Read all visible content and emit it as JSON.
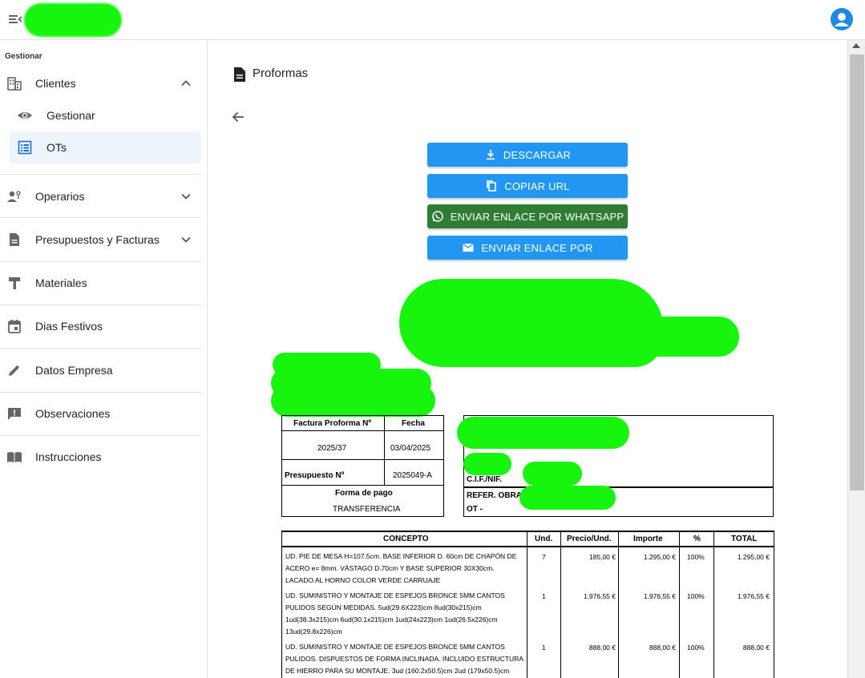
{
  "sidebar": {
    "section_title": "Gestionar",
    "items": [
      {
        "label": "Clientes"
      },
      {
        "label": "Gestionar"
      },
      {
        "label": "OTs"
      },
      {
        "label": "Operarios"
      },
      {
        "label": "Presupuestos y Facturas"
      },
      {
        "label": "Materiales"
      },
      {
        "label": "Dias Festivos"
      },
      {
        "label": "Datos Empresa"
      },
      {
        "label": "Observaciones"
      },
      {
        "label": "Instrucciones"
      }
    ]
  },
  "main": {
    "title": "Proformas",
    "buttons": {
      "download": "DESCARGAR",
      "copy_url": "COPIAR URL",
      "whatsapp": "ENVIAR ENLACE POR WHATSAPP",
      "email": "ENVIAR ENLACE POR"
    }
  },
  "invoice": {
    "header": {
      "number_label": "Factura Proforma Nº",
      "date_label": "Fecha",
      "number": "2025/37",
      "date": "03/04/2025",
      "budget_label": "Presupuesto Nº",
      "budget": "2025049-A",
      "payment_label": "Forma de pago",
      "payment": "TRANSFERENCIA",
      "cif_label": "C.I.F./NIF.",
      "ref_label": "REFER. OBRA",
      "ot_label": "OT -"
    },
    "columns": [
      "CONCEPTO",
      "Und.",
      "Precio/Und.",
      "Importe",
      "%",
      "TOTAL"
    ],
    "rows": [
      {
        "concepto": [
          "UD. PIE DE MESA H=107.5cm. BASE INFERIOR D. 60cm DE CHAPÓN DE",
          "ACERO e= 8mm. VÁSTAGO D.70cm Y BASE SUPERIOR 30X30cm.",
          "LACADO AL HORNO COLOR VERDE CARRUAJE"
        ],
        "und": "7",
        "precio": "185,00 €",
        "importe": "1.295,00 €",
        "pct": "100%",
        "total": "1.295,00 €"
      },
      {
        "concepto": [
          "UD. SUMINISTRO Y MONTAJE DE ESPEJOS BRONCE 5MM CANTOS",
          "PULIDOS SEGÚN MEDIDAS. 5ud(29.6X223)cm 8ud(30x215)cm",
          "1ud(38.3x215)cm 6ud(30.1x215)cm 1ud(24x223)cm 1ud(26.5x226)cm",
          "13ud(29.8x226)cm"
        ],
        "und": "1",
        "precio": "1.976,55 €",
        "importe": "1.976,55 €",
        "pct": "100%",
        "total": "1.976,55 €"
      },
      {
        "concepto": [
          "UD. SUMINISTRO Y MONTAJE DE ESPEJOS BRONCE 5MM CANTOS",
          "PULIDOS. DISPUESTOS DE FORMA INCLINADA. INCLUIDO ESTRUCTURA",
          "DE HIERRO PARA SU MONTAJE. 3ud (160.2x50.5)cm 2ud (179x50.5)cm"
        ],
        "und": "1",
        "precio": "888,00 €",
        "importe": "888,00 €",
        "pct": "100%",
        "total": "888,00 €"
      }
    ]
  },
  "colors": {
    "primary": "#2196f3",
    "whatsapp": "#2e7d32",
    "active_bg": "#edf4fb",
    "redaction": "#17f50f",
    "avatar": "#1e88e5"
  },
  "icons": [
    "menu-open-icon",
    "account-icon",
    "building-icon",
    "chevron-up-icon",
    "eye-icon",
    "list-icon",
    "workers-icon",
    "chevron-down-icon",
    "document-icon",
    "hammer-icon",
    "calendar-icon",
    "pencil-icon",
    "alert-icon",
    "book-icon",
    "arrow-back-icon",
    "download-icon",
    "copy-icon",
    "whatsapp-icon",
    "mail-icon"
  ]
}
